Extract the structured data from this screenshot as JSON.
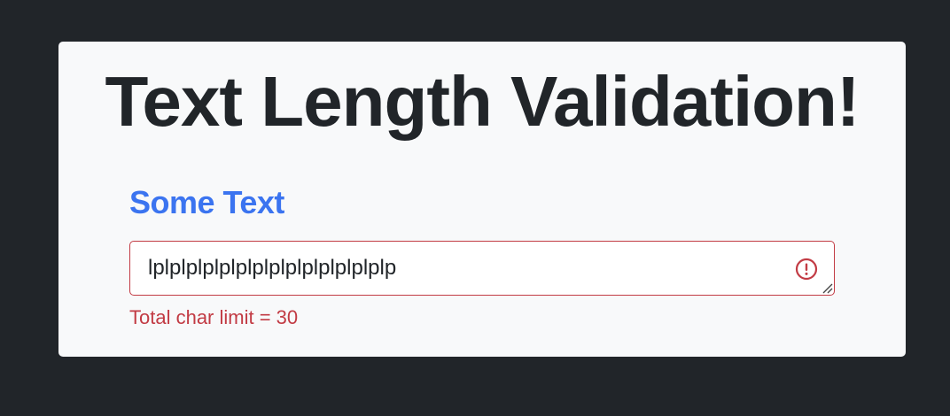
{
  "title": "Text Length Validation!",
  "field": {
    "label": "Some Text",
    "value": "lplplplplplplplplplplplplplplp",
    "error_message": "Total char limit = 30",
    "status": "invalid",
    "status_icon": "error-exclamation-circle-icon"
  },
  "colors": {
    "background": "#212529",
    "card": "#f8f9fa",
    "title": "#212529",
    "label": "#3b74f0",
    "error": "#c23b44"
  }
}
